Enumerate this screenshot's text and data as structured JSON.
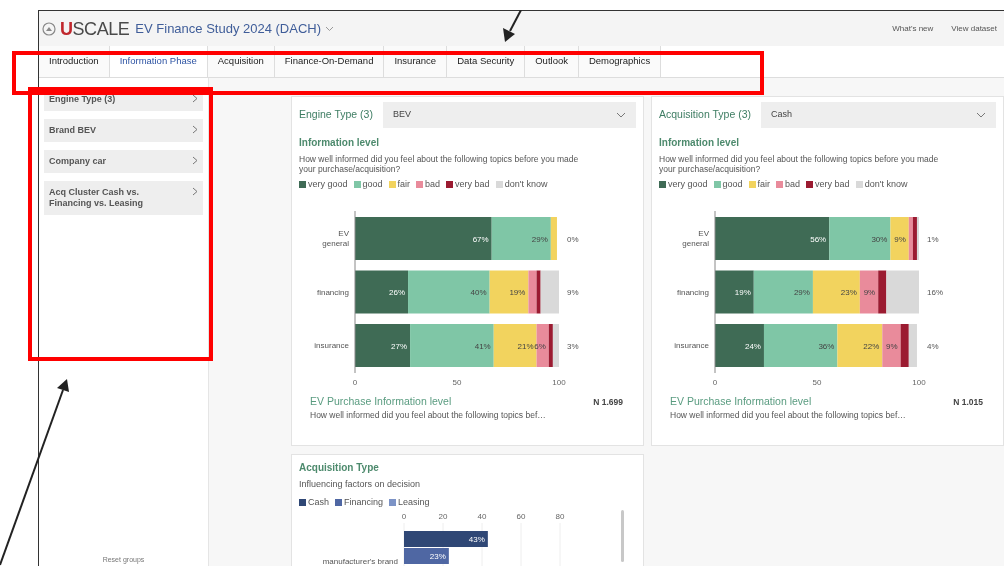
{
  "header": {
    "logo": "USCALE",
    "title": "EV Finance Study 2024 (DACH)",
    "links": [
      "What's new",
      "View dataset"
    ]
  },
  "tabs": [
    {
      "label": "Introduction",
      "selected": false
    },
    {
      "label": "Information Phase",
      "selected": true
    },
    {
      "label": "Acquisition",
      "selected": false
    },
    {
      "label": "Finance-On-Demand",
      "selected": false
    },
    {
      "label": "Insurance",
      "selected": false
    },
    {
      "label": "Data Security",
      "selected": false
    },
    {
      "label": "Outlook",
      "selected": false
    },
    {
      "label": "Demographics",
      "selected": false
    }
  ],
  "sidebar": {
    "items": [
      "Engine Type (3)",
      "Brand BEV",
      "Company car",
      "Acq Cluster Cash vs. Financing vs. Leasing"
    ],
    "footer": "Reset groups"
  },
  "cards": [
    {
      "filter_label": "Engine Type (3)",
      "filter_value": "BEV",
      "title": "Information level",
      "question": "How well informed did you feel about the following topics before you made your purchase/acquisition?",
      "footer_title": "EV Purchase Information level",
      "n": "N 1.699",
      "footer_text": "How well informed did you feel about the following topics bef…",
      "chart_data": {
        "type": "bar",
        "orientation": "horizontal",
        "stacked": true,
        "categories": [
          "EV general",
          "financing",
          "insurance"
        ],
        "xlim": [
          0,
          100
        ],
        "xticks": [
          0,
          50,
          100
        ],
        "series": [
          {
            "name": "very good",
            "color": "#3f6b55",
            "values": [
              67,
              26,
              27
            ],
            "value_labels": [
              "67%",
              "26%",
              "27%"
            ]
          },
          {
            "name": "good",
            "color": "#7fc6a6",
            "values": [
              29,
              40,
              41
            ],
            "value_labels": [
              "29%",
              "40%",
              "41%"
            ]
          },
          {
            "name": "fair",
            "color": "#f2d35e",
            "values": [
              3,
              19,
              21
            ],
            "value_labels": [
              null,
              "19%",
              "21%"
            ]
          },
          {
            "name": "bad",
            "color": "#e98b9b",
            "values": [
              0,
              4,
              6
            ],
            "value_labels": [
              null,
              null,
              "6%"
            ]
          },
          {
            "name": "very bad",
            "color": "#9b1b31",
            "values": [
              0,
              2,
              2
            ],
            "value_labels": [
              null,
              null,
              null
            ]
          },
          {
            "name": "don't know",
            "color": "#d9d9d9",
            "values": [
              0,
              9,
              3
            ],
            "value_labels": [
              "0%",
              "9%",
              "3%"
            ]
          }
        ]
      }
    },
    {
      "filter_label": "Acquisition Type (3)",
      "filter_value": "Cash",
      "title": "Information level",
      "question": "How well informed did you feel about the following topics before you made your purchase/acquisition?",
      "footer_title": "EV Purchase Information level",
      "n": "N 1.015",
      "footer_text": "How well informed did you feel about the following topics bef…",
      "chart_data": {
        "type": "bar",
        "orientation": "horizontal",
        "stacked": true,
        "categories": [
          "EV general",
          "financing",
          "insurance"
        ],
        "xlim": [
          0,
          100
        ],
        "xticks": [
          0,
          50,
          100
        ],
        "series": [
          {
            "name": "very good",
            "color": "#3f6b55",
            "values": [
              56,
              19,
              24
            ],
            "value_labels": [
              "56%",
              "19%",
              "24%"
            ]
          },
          {
            "name": "good",
            "color": "#7fc6a6",
            "values": [
              30,
              29,
              36
            ],
            "value_labels": [
              "30%",
              "29%",
              "36%"
            ]
          },
          {
            "name": "fair",
            "color": "#f2d35e",
            "values": [
              9,
              23,
              22
            ],
            "value_labels": [
              "9%",
              "23%",
              "22%"
            ]
          },
          {
            "name": "bad",
            "color": "#e98b9b",
            "values": [
              2,
              9,
              9
            ],
            "value_labels": [
              null,
              "9%",
              "9%"
            ]
          },
          {
            "name": "very bad",
            "color": "#9b1b31",
            "values": [
              2,
              4,
              4
            ],
            "value_labels": [
              null,
              null,
              null
            ]
          },
          {
            "name": "don't know",
            "color": "#d9d9d9",
            "values": [
              1,
              16,
              4
            ],
            "value_labels": [
              "1%",
              "16%",
              "4%"
            ]
          }
        ]
      }
    }
  ],
  "bottom_card": {
    "title": "Acquisition Type",
    "subtitle": "Influencing factors on decision",
    "chart_data": {
      "type": "bar",
      "orientation": "horizontal",
      "categories": [
        "manufacturer's brand"
      ],
      "xlim": [
        0,
        80
      ],
      "xticks": [
        0,
        20,
        40,
        60,
        80
      ],
      "grid": true,
      "series": [
        {
          "name": "Cash",
          "color": "#2f4775",
          "values": [
            43
          ],
          "value_labels": [
            "43%"
          ]
        },
        {
          "name": "Financing",
          "color": "#4f67a3",
          "values": [
            23
          ],
          "value_labels": [
            "23%"
          ]
        },
        {
          "name": "Leasing",
          "color": "#7c93c6",
          "values": [
            null
          ],
          "value_labels": [
            null
          ]
        }
      ]
    }
  }
}
